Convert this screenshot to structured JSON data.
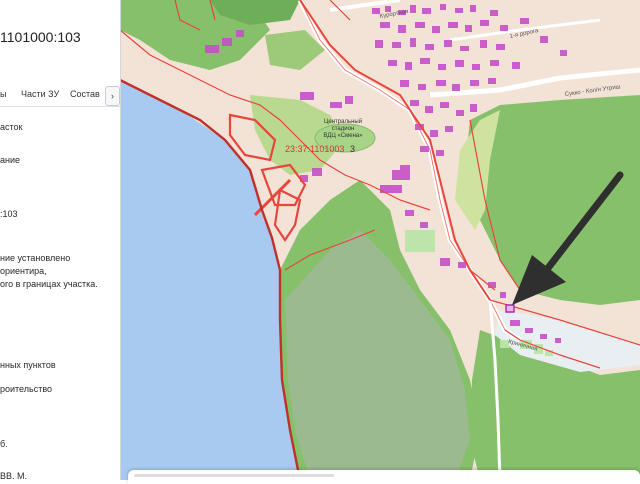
{
  "panel": {
    "cadastral_number": "1101000:103",
    "tabs": [
      "ы",
      "Части ЗУ",
      "Состав"
    ],
    "tab_next_icon": "chevron-right-icon",
    "lines": [
      "асток",
      "ание",
      ":103",
      "ние установлено",
      "ориентира,",
      "ого в границах участка.",
      "нных пунктов",
      "роительство",
      "б.",
      "ВВ. М."
    ]
  },
  "map": {
    "stadium_label_line1": "Центральный",
    "stadium_label_line2": "стадион",
    "stadium_label_line3": "ВДЦ «Смена»",
    "district_label": "23:37:1101003",
    "district_suffix": "3",
    "street_sukko": "Сукко - Кол/н Утриш",
    "street_small": "Криничная",
    "street_top": "Курортная",
    "street_top_right": "1-я дорога",
    "colors": {
      "sea": "#a8c9f0",
      "land": "#f3e2d6",
      "forest": "#86c06a",
      "forest_light": "#b9d98f",
      "buildings": "#c64fc9",
      "boundary": "#e8453c",
      "road": "#ffffff",
      "arrow": "#2f2f2f"
    }
  }
}
